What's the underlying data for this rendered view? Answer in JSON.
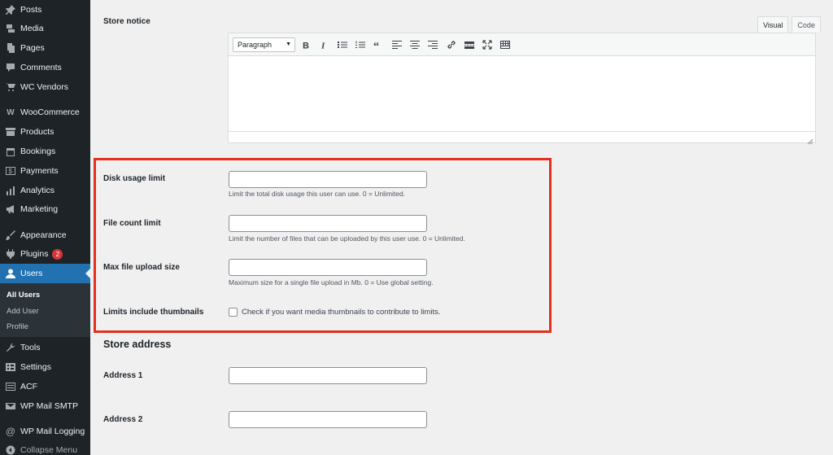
{
  "sidebar": {
    "items": [
      {
        "label": "Posts",
        "icon": "pin-icon"
      },
      {
        "label": "Media",
        "icon": "media-icon"
      },
      {
        "label": "Pages",
        "icon": "pages-icon"
      },
      {
        "label": "Comments",
        "icon": "comments-icon"
      },
      {
        "label": "WC Vendors",
        "icon": "cart-icon"
      },
      {
        "label": "WooCommerce",
        "icon": "woo-icon"
      },
      {
        "label": "Products",
        "icon": "archive-icon"
      },
      {
        "label": "Bookings",
        "icon": "calendar-icon"
      },
      {
        "label": "Payments",
        "icon": "dollar-icon"
      },
      {
        "label": "Analytics",
        "icon": "chart-icon"
      },
      {
        "label": "Marketing",
        "icon": "megaphone-icon"
      },
      {
        "label": "Appearance",
        "icon": "brush-icon"
      },
      {
        "label": "Plugins",
        "icon": "plug-icon",
        "badge": "2"
      },
      {
        "label": "Users",
        "icon": "users-icon"
      },
      {
        "label": "Tools",
        "icon": "wrench-icon"
      },
      {
        "label": "Settings",
        "icon": "settings-icon"
      },
      {
        "label": "ACF",
        "icon": "acf-icon"
      },
      {
        "label": "WP Mail SMTP",
        "icon": "mail-icon"
      },
      {
        "label": "WP Mail Logging",
        "icon": "at-icon"
      }
    ],
    "submenu": [
      "All Users",
      "Add User",
      "Profile"
    ],
    "collapse_label": "Collapse Menu"
  },
  "editor": {
    "label": "Store notice",
    "tabs": [
      "Visual",
      "Code"
    ],
    "format_select": "Paragraph",
    "toolbar_icons": [
      "bold-icon",
      "italic-icon",
      "bulleted-list-icon",
      "numbered-list-icon",
      "blockquote-icon",
      "align-left-icon",
      "align-center-icon",
      "align-right-icon",
      "link-icon",
      "read-more-icon",
      "fullscreen-icon",
      "toolbar-toggle-icon"
    ]
  },
  "limits": {
    "disk_usage": {
      "label": "Disk usage limit",
      "value": "",
      "description": "Limit the total disk usage this user can use. 0 = Unlimited."
    },
    "file_count": {
      "label": "File count limit",
      "value": "",
      "description": "Limit the number of files that can be uploaded by this user use. 0 = Unlimited."
    },
    "max_upload": {
      "label": "Max file upload size",
      "value": "",
      "description": "Maximum size for a single file upload in Mb. 0 = Use global setting."
    },
    "thumbnails": {
      "label": "Limits include thumbnails",
      "checkbox_label": "Check if you want media thumbnails to contribute to limits.",
      "checked": false
    }
  },
  "store_address": {
    "title": "Store address",
    "address1_label": "Address 1",
    "address2_label": "Address 2",
    "address1_value": "",
    "address2_value": ""
  },
  "colors": {
    "highlight": "#e3301f",
    "sidebar_bg": "#1d2327",
    "active": "#2271b1"
  }
}
